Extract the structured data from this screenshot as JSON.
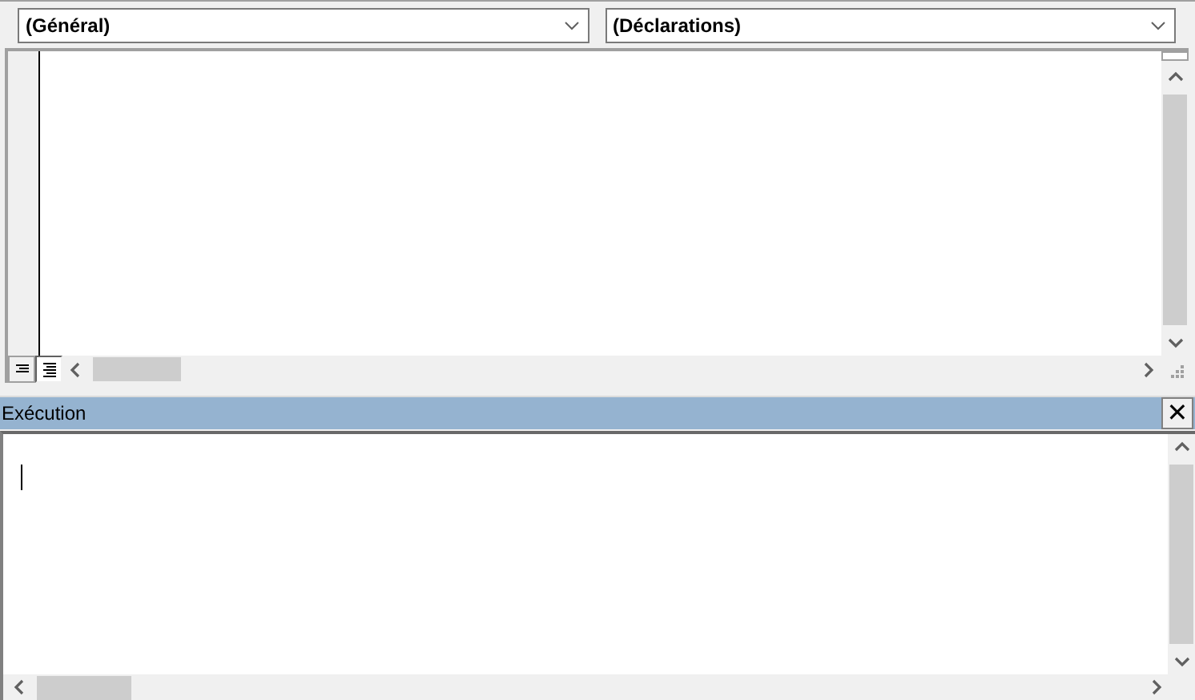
{
  "code_window": {
    "dropdowns": [
      {
        "value": "(Général)"
      },
      {
        "value": "(Déclarations)"
      }
    ],
    "view_buttons": [
      {
        "kind": "procedure",
        "selected": false
      },
      {
        "kind": "module",
        "selected": true
      }
    ]
  },
  "immediate_window": {
    "title": "Exécution",
    "close": "✕"
  }
}
